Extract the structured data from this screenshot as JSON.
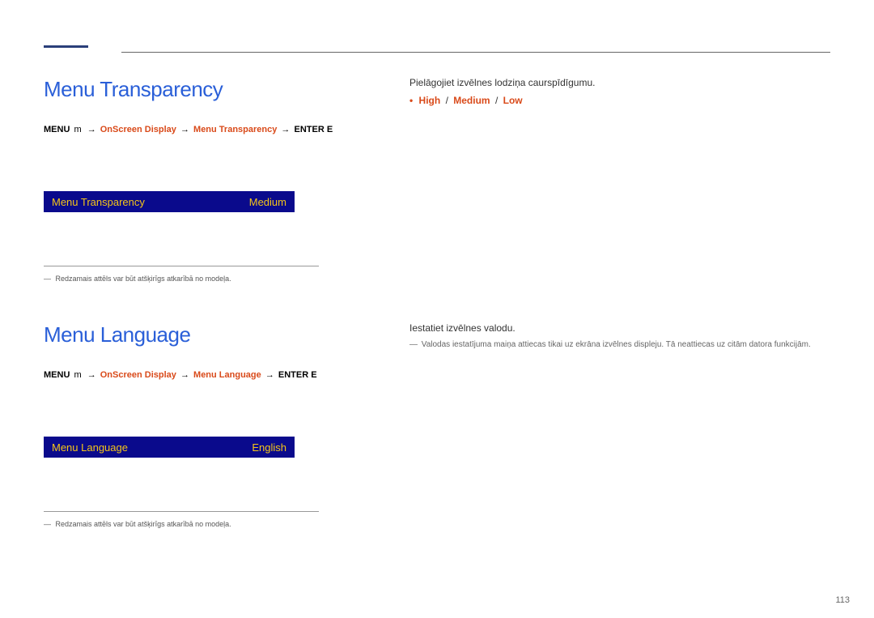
{
  "page_number": "113",
  "section1": {
    "title": "Menu Transparency",
    "breadcrumb": {
      "menu": "MENU",
      "arrow": "m",
      "item1": "OnScreen Display",
      "item2": "Menu Transparency",
      "enter": "ENTER",
      "enter_icon": "E"
    },
    "desc": "Pielāgojiet izvēlnes lodziņa caurspīdīgumu.",
    "options": {
      "bullet": "•",
      "opt1": "High",
      "opt2": "Medium",
      "opt3": "Low"
    },
    "menubox": {
      "label": "Menu Transparency",
      "value": "Medium"
    },
    "note": "Redzamais attēls var būt atšķirīgs atkarībā no modeļa."
  },
  "section2": {
    "title": "Menu Language",
    "breadcrumb": {
      "menu": "MENU",
      "arrow": "m",
      "item1": "OnScreen Display",
      "item2": "Menu Language",
      "enter": "ENTER",
      "enter_icon": "E"
    },
    "desc": "Iestatiet izvēlnes valodu.",
    "subnote": "Valodas iestatījuma maiņa attiecas tikai uz ekrāna izvēlnes displeju. Tā neattiecas uz citām datora funkcijām.",
    "menubox": {
      "label": "Menu Language",
      "value": "English"
    },
    "note": "Redzamais attēls var būt atšķirīgs atkarībā no modeļa."
  }
}
